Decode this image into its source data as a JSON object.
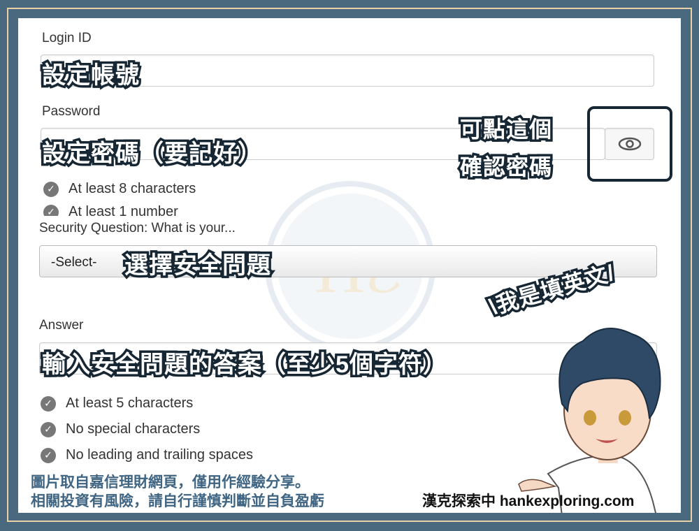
{
  "form": {
    "login_label": "Login ID",
    "password_label": "Password",
    "password_checks": [
      "At least 8 characters",
      "At least 1 number"
    ],
    "security_label": "Security Question: What is your...",
    "security_select": "-Select-",
    "answer_label": "Answer",
    "answer_checks": [
      "At least 5 characters",
      "No special characters",
      "No leading and trailing spaces"
    ],
    "eye_icon": "eye-icon"
  },
  "annotations": {
    "login": "設定帳號",
    "password": "設定密碼（要記好）",
    "eye_line1": "可點這個",
    "eye_line2": "確認密碼",
    "security": "選擇安全問題",
    "answer": "輸入安全問題的答案（至少5個字符）",
    "english": "\\我是填英文/"
  },
  "footer": {
    "disclaimer1": "圖片取自嘉信理財網頁，僅用作經驗分享。",
    "disclaimer2": "相關投資有風險，請自行謹慎判斷並自負盈虧",
    "brand": "漢克探索中 hankexploring.com"
  },
  "colors": {
    "frame": "#4a697f",
    "accent_border": "#e9d3a6",
    "footer_text": "#3f6583",
    "outline": "#162633"
  }
}
